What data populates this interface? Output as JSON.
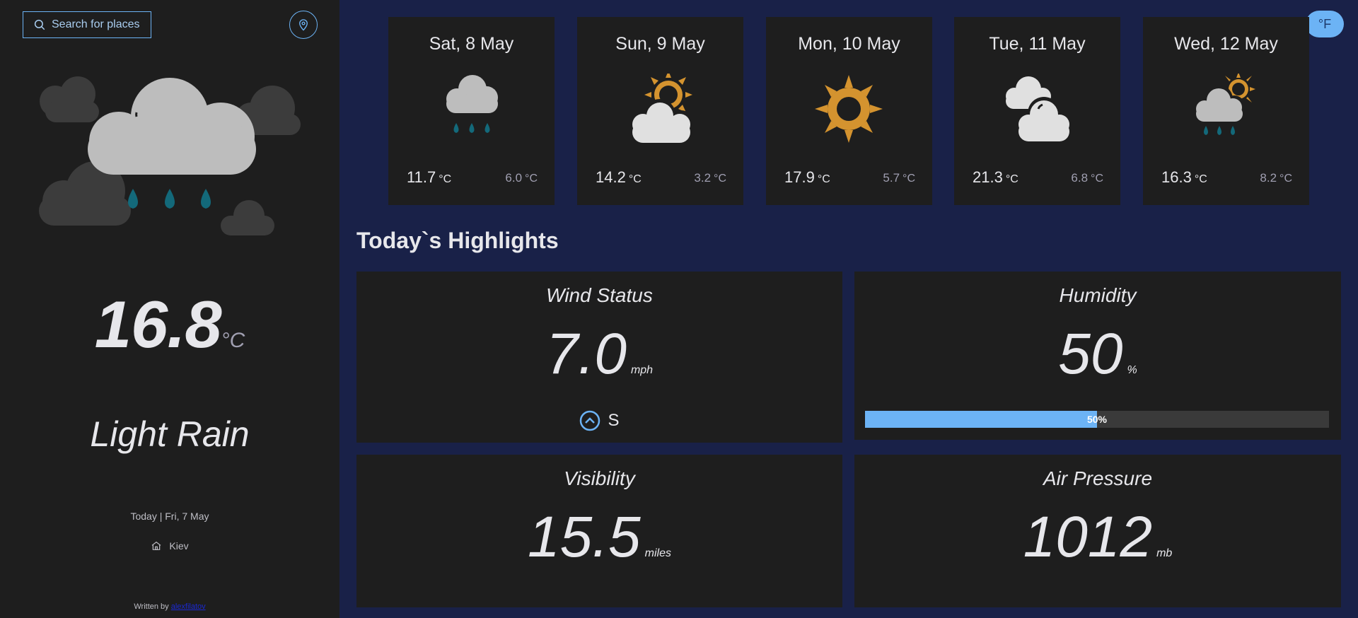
{
  "search": {
    "label": "Search for places"
  },
  "current": {
    "temp": "16.8",
    "unit": "°C",
    "condition": "Light Rain",
    "date_line": "Today  |  Fri, 7 May",
    "location": "Kiev"
  },
  "credit": {
    "prefix": "Written by",
    "link_text": "alexfilatov"
  },
  "unit_toggle": {
    "label": "°F"
  },
  "forecast": [
    {
      "day": "Sat, 8 May",
      "icon": "light-rain-icon",
      "max": "11.7",
      "min": "6.0",
      "unit": "°C"
    },
    {
      "day": "Sun, 9 May",
      "icon": "partly-cloudy-icon",
      "max": "14.2",
      "min": "3.2",
      "unit": "°C"
    },
    {
      "day": "Mon, 10 May",
      "icon": "sunny-icon",
      "max": "17.9",
      "min": "5.7",
      "unit": "°C"
    },
    {
      "day": "Tue, 11 May",
      "icon": "cloudy-icon",
      "max": "21.3",
      "min": "6.8",
      "unit": "°C"
    },
    {
      "day": "Wed, 12 May",
      "icon": "sun-showers-icon",
      "max": "16.3",
      "min": "8.2",
      "unit": "°C"
    }
  ],
  "highlights": {
    "title": "Today`s Highlights",
    "wind": {
      "title": "Wind Status",
      "value": "7.0",
      "unit": "mph",
      "direction": "S"
    },
    "humidity": {
      "title": "Humidity",
      "value": "50",
      "unit": "%",
      "bar_label": "50%",
      "fraction": 0.5
    },
    "visibility": {
      "title": "Visibility",
      "value": "15.5",
      "unit": "miles"
    },
    "pressure": {
      "title": "Air Pressure",
      "value": "1012",
      "unit": "mb"
    }
  },
  "colors": {
    "accent": "#6cb3f5",
    "sun": "#d4932f",
    "rain": "#13697a",
    "cloud": "#bdbdbd",
    "cloud_dark": "#3c3c3c",
    "panel": "#1e1e1e",
    "background": "#192148"
  }
}
